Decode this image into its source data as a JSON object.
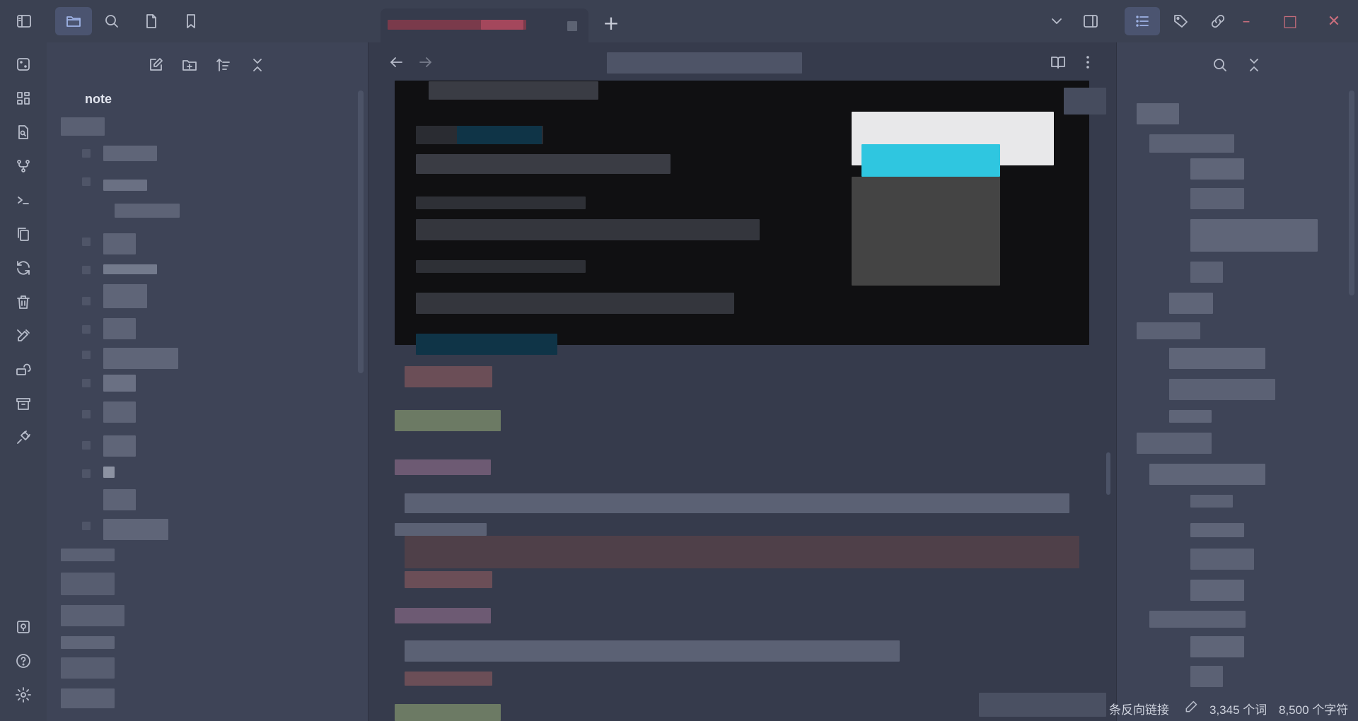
{
  "file_tree": {
    "root_label": "note"
  },
  "status_bar": {
    "backlinks": "条反向链接",
    "words": "3,345 个词",
    "chars": "8,500 个字符"
  },
  "window_controls": {
    "minimize": "–",
    "maximize": "□",
    "close": "✕"
  },
  "tab_bar": {
    "new_tab": "+"
  },
  "colors": {
    "accent": "#9fb3e6",
    "window_control": "#c66d7c",
    "code_block": "#101012"
  }
}
